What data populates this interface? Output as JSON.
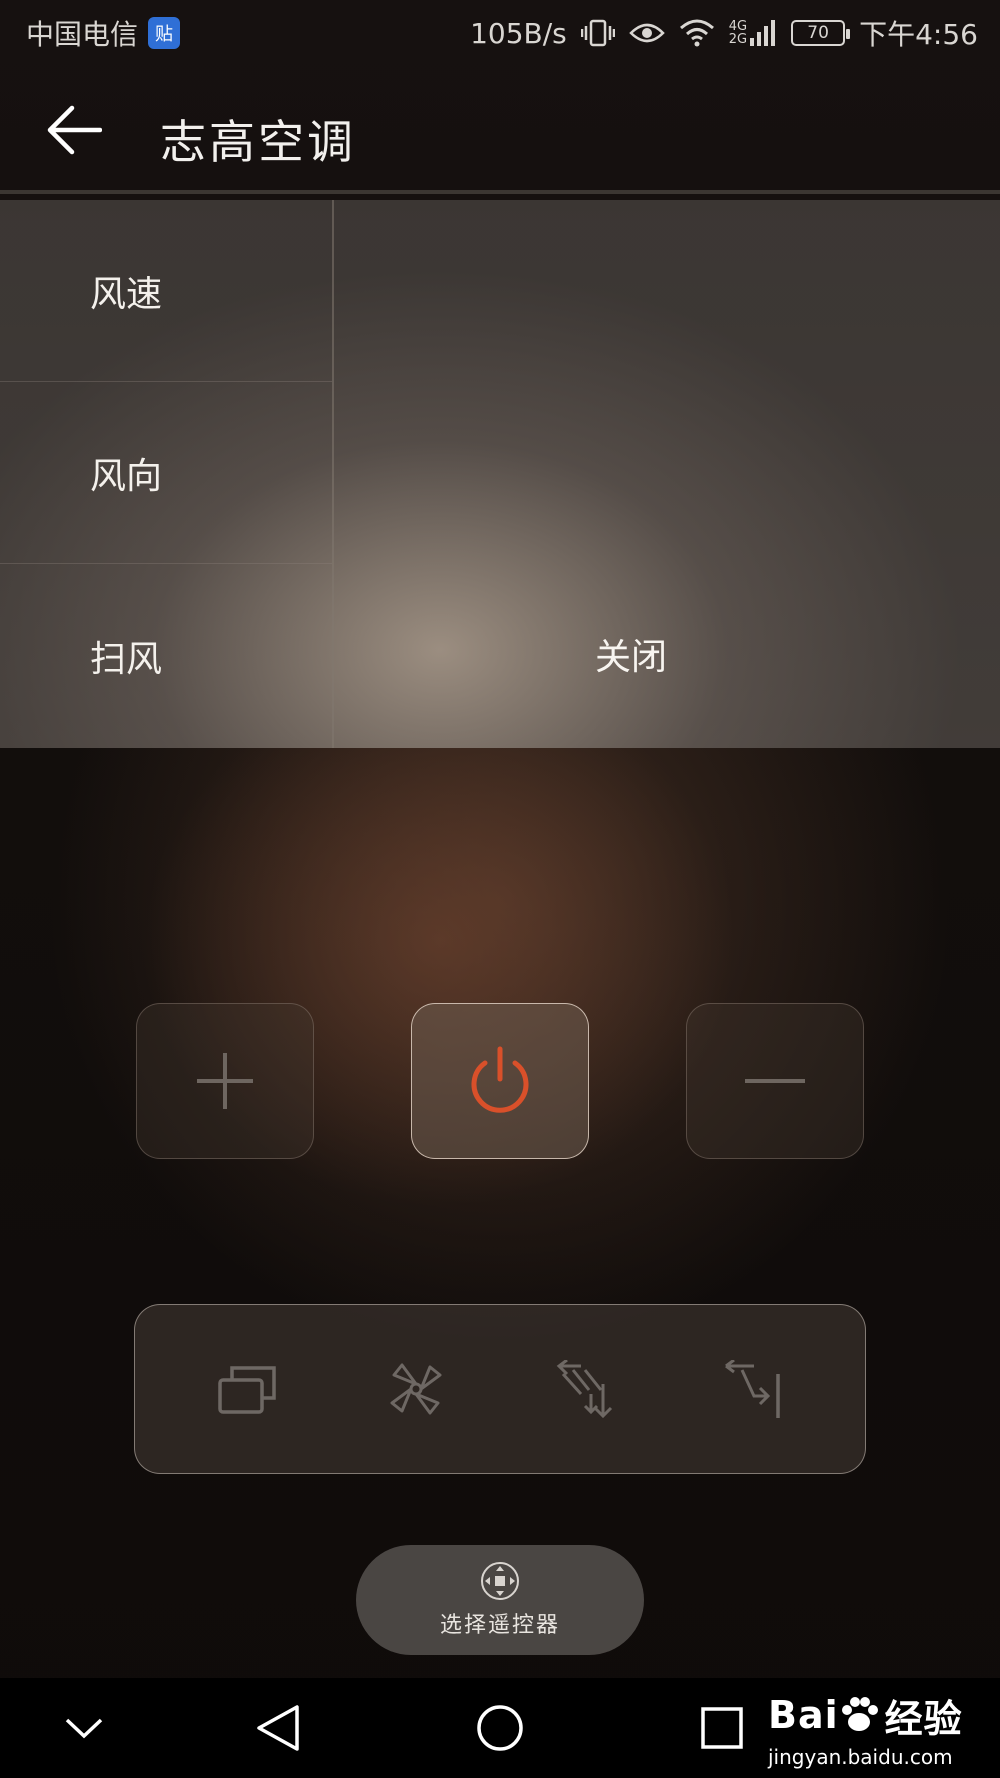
{
  "status_bar": {
    "carrier": "中国电信",
    "carrier_badge": "贴",
    "network_speed": "105B/s",
    "network_type_top": "4G",
    "network_type_bottom": "2G",
    "battery": "70",
    "time": "下午4:56"
  },
  "header": {
    "title": "志高空调"
  },
  "settings": {
    "items": [
      {
        "label": "风速"
      },
      {
        "label": "风向"
      },
      {
        "label": "扫风"
      }
    ],
    "selected_value": "关闭"
  },
  "controls": {
    "plus": "plus-icon",
    "power": "power-icon",
    "minus": "minus-icon",
    "power_color": "#d9502a"
  },
  "mode_toolbar": {
    "icons": [
      "mode-icon",
      "fan-icon",
      "swing-direction-icon",
      "sweep-icon"
    ]
  },
  "remote_selector": {
    "label": "选择遥控器"
  },
  "watermark": {
    "logo_prefix": "Bai",
    "logo_suffix": "经验",
    "url": "jingyan.baidu.com"
  }
}
